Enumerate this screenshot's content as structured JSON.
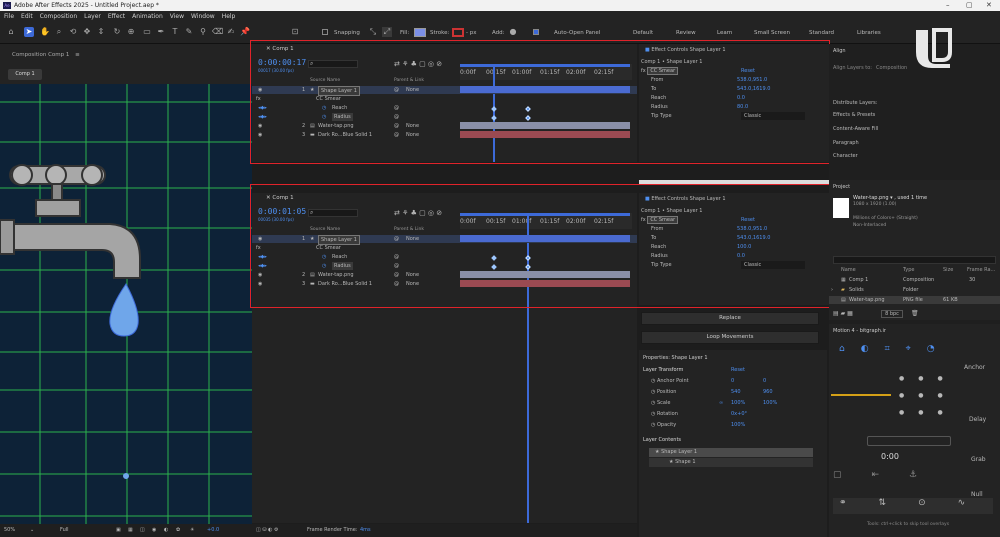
{
  "app": {
    "title": "Adobe After Effects 2025 - Untitled Project.aep *",
    "logo_text": "Ae"
  },
  "menu": [
    "File",
    "Edit",
    "Composition",
    "Layer",
    "Effect",
    "Animation",
    "View",
    "Window",
    "Help"
  ],
  "toolbar": {
    "snapping": "Snapping",
    "fill": "Fill:",
    "stroke": "Stroke:",
    "stroke_px": "- px",
    "add": "Add:",
    "auto_open": "Auto-Open Panel",
    "workspaces": [
      "Default",
      "Review",
      "Learn",
      "Small Screen",
      "Standard",
      "Libraries"
    ]
  },
  "comp_panel": {
    "header": "Composition Comp 1",
    "tab": "Comp 1",
    "zoom": "50%",
    "quality": "Full",
    "exposure": "+0.0"
  },
  "timeline_top": {
    "tab": "Comp 1",
    "timecode": "0:00:00:17",
    "timecode_sub": "00017 (30.00 fps)",
    "ruler": [
      "0:00f",
      "00:15f",
      "01:00f",
      "01:15f",
      "02:00f",
      "02:15f"
    ],
    "col_source": "Source Name",
    "col_parent": "Parent & Link",
    "layers": [
      {
        "num": "1",
        "name": "Shape Layer 1",
        "parent": "None"
      },
      {
        "num": "",
        "name": "CC Smear",
        "parent": ""
      },
      {
        "num": "",
        "name": "Reach",
        "parent": ""
      },
      {
        "num": "",
        "name": "Radius",
        "parent": ""
      },
      {
        "num": "2",
        "name": "Water-tap.png",
        "parent": "None"
      },
      {
        "num": "3",
        "name": "Dark Ro...Blue Solid 1",
        "parent": "None"
      }
    ]
  },
  "timeline_bottom": {
    "tab": "Comp 1",
    "timecode": "0:00:01:05",
    "timecode_sub": "00035 (30.00 fps)",
    "ruler": [
      "0:00f",
      "00:15f",
      "01:00f",
      "01:15f",
      "02:00f",
      "02:15f"
    ],
    "col_source": "Source Name",
    "col_parent": "Parent & Link",
    "layers": [
      {
        "num": "1",
        "name": "Shape Layer 1",
        "parent": "None"
      },
      {
        "num": "",
        "name": "CC Smear",
        "parent": ""
      },
      {
        "num": "",
        "name": "Reach",
        "parent": ""
      },
      {
        "num": "",
        "name": "Radius",
        "parent": ""
      },
      {
        "num": "2",
        "name": "Water-tap.png",
        "parent": "None"
      },
      {
        "num": "3",
        "name": "Dark Ro...Blue Solid 1",
        "parent": "None"
      }
    ]
  },
  "effect_controls_top": {
    "tab": "Effect Controls Shape Layer 1",
    "breadcrumb": "Comp 1 • Shape Layer 1",
    "effect": "CC Smear",
    "reset": "Reset",
    "rows": [
      {
        "label": "From",
        "value": "538.0,951.0"
      },
      {
        "label": "To",
        "value": "543.0,1619.0"
      },
      {
        "label": "Reach",
        "value": "0.0"
      },
      {
        "label": "Radius",
        "value": "80.0"
      },
      {
        "label": "Tip Type",
        "value": "Classic"
      }
    ]
  },
  "effect_controls_bottom": {
    "tab": "Effect Controls Shape Layer 1",
    "breadcrumb": "Comp 1 • Shape Layer 1",
    "effect": "CC Smear",
    "reset": "Reset",
    "rows": [
      {
        "label": "From",
        "value": "538.0,951.0"
      },
      {
        "label": "To",
        "value": "543.0,1619.0"
      },
      {
        "label": "Reach",
        "value": "100.0"
      },
      {
        "label": "Radius",
        "value": "0.0"
      },
      {
        "label": "Tip Type",
        "value": "Classic"
      }
    ]
  },
  "right_top_panels": [
    "Align",
    "Distribute Layers:",
    "Effects & Presets",
    "Content-Aware Fill",
    "Paragraph",
    "Character"
  ],
  "align_sub": {
    "layers_to": "Align Layers to:",
    "composition": "Composition"
  },
  "project": {
    "title": "Project",
    "file_name": "Water-tap.png ▾ , used 1 time",
    "file_dims": "1080 x 1920 (1.00)",
    "file_color": "Millions of Colors+ (Straight)",
    "file_interlace": "Non-Interlaced",
    "cols": [
      "Name",
      "Type",
      "Size",
      "Frame Ra..."
    ],
    "items": [
      {
        "name": "Comp 1",
        "type": "Composition",
        "size": "",
        "fr": "30"
      },
      {
        "name": "Solids",
        "type": "Folder",
        "size": "",
        "fr": ""
      },
      {
        "name": "Water-tap.png",
        "type": "PNG file",
        "size": "61 KB",
        "fr": ""
      }
    ],
    "bpc": "8 bpc"
  },
  "middle_buttons": {
    "replace": "Replace",
    "loop": "Loop Movements"
  },
  "properties": {
    "title": "Properties: Shape Layer 1",
    "section": "Layer Transform",
    "reset": "Reset",
    "rows": [
      {
        "label": "Anchor Point",
        "v1": "0",
        "v2": "0"
      },
      {
        "label": "Position",
        "v1": "540",
        "v2": "960"
      },
      {
        "label": "Scale",
        "v1": "100%",
        "v2": "100%"
      },
      {
        "label": "Rotation",
        "v1": "0x+0°",
        "v2": ""
      },
      {
        "label": "Opacity",
        "v1": "100%",
        "v2": ""
      }
    ],
    "contents_title": "Layer Contents",
    "contents": [
      "Shape Layer 1",
      "Shape 1"
    ]
  },
  "motion": {
    "title": "Motion 4 - bitgraph.ir",
    "labels": [
      "Anchor",
      "Delay",
      "Grab",
      "Null"
    ],
    "tooltip": "Tools: ctrl+click to skip tool overlays"
  },
  "footer": {
    "render_label": "Frame Render Time:",
    "render_value": "4ms"
  },
  "colors": {
    "accent": "#4e8ff0",
    "highlight_box": "#e0232a",
    "viewer_bg": "#0d2237",
    "grid": "#2bb24c",
    "layer1_bar": "#4a6ad0",
    "layer2_bar": "#8a8fa8",
    "layer3_bar": "#9b4a52"
  }
}
